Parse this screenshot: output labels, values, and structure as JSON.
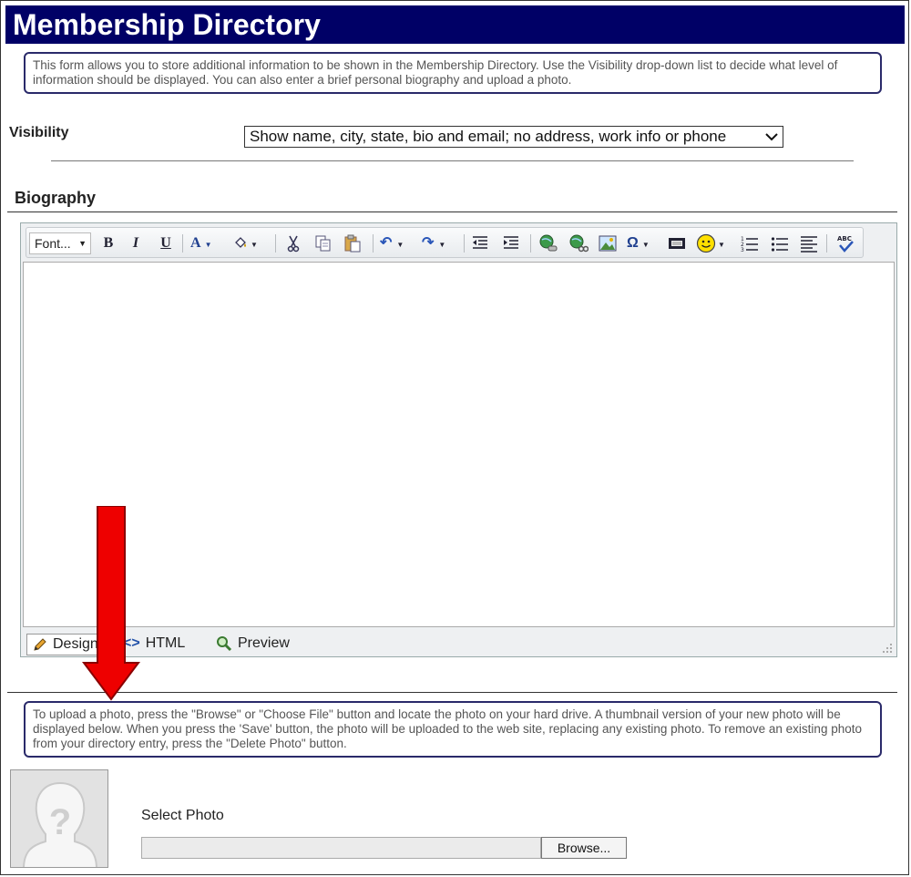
{
  "header": {
    "title": "Membership Directory"
  },
  "intro": {
    "text": "This form allows you to store additional information to be shown in the Membership Directory. Use the Visibility drop-down list to decide what level of information should be displayed. You can also enter a brief personal biography and upload a photo."
  },
  "visibility": {
    "label": "Visibility",
    "selected": "Show name, city, state, bio and email; no address, work info or phone"
  },
  "biography": {
    "heading": "Biography",
    "toolbar": {
      "font": "Font...",
      "bold": "B",
      "italic": "I",
      "underline": "U",
      "forecolor": "A",
      "special_char": "Ω"
    },
    "modes": {
      "design": "Design",
      "html": "HTML",
      "preview": "Preview"
    }
  },
  "upload": {
    "instructions": "To upload a photo, press the \"Browse\" or \"Choose File\" button and locate the photo on your hard drive. A thumbnail version of your new photo will be displayed below. When you press the 'Save' button, the photo will be uploaded to the web site, replacing any existing photo. To remove an existing photo from your directory entry, press the \"Delete Photo\" button.",
    "select_label": "Select Photo",
    "browse_label": "Browse...",
    "placeholder_glyph": "?"
  },
  "colors": {
    "title_bg": "#000066",
    "arrow": "#ee0000",
    "border": "#2a2a6a"
  }
}
